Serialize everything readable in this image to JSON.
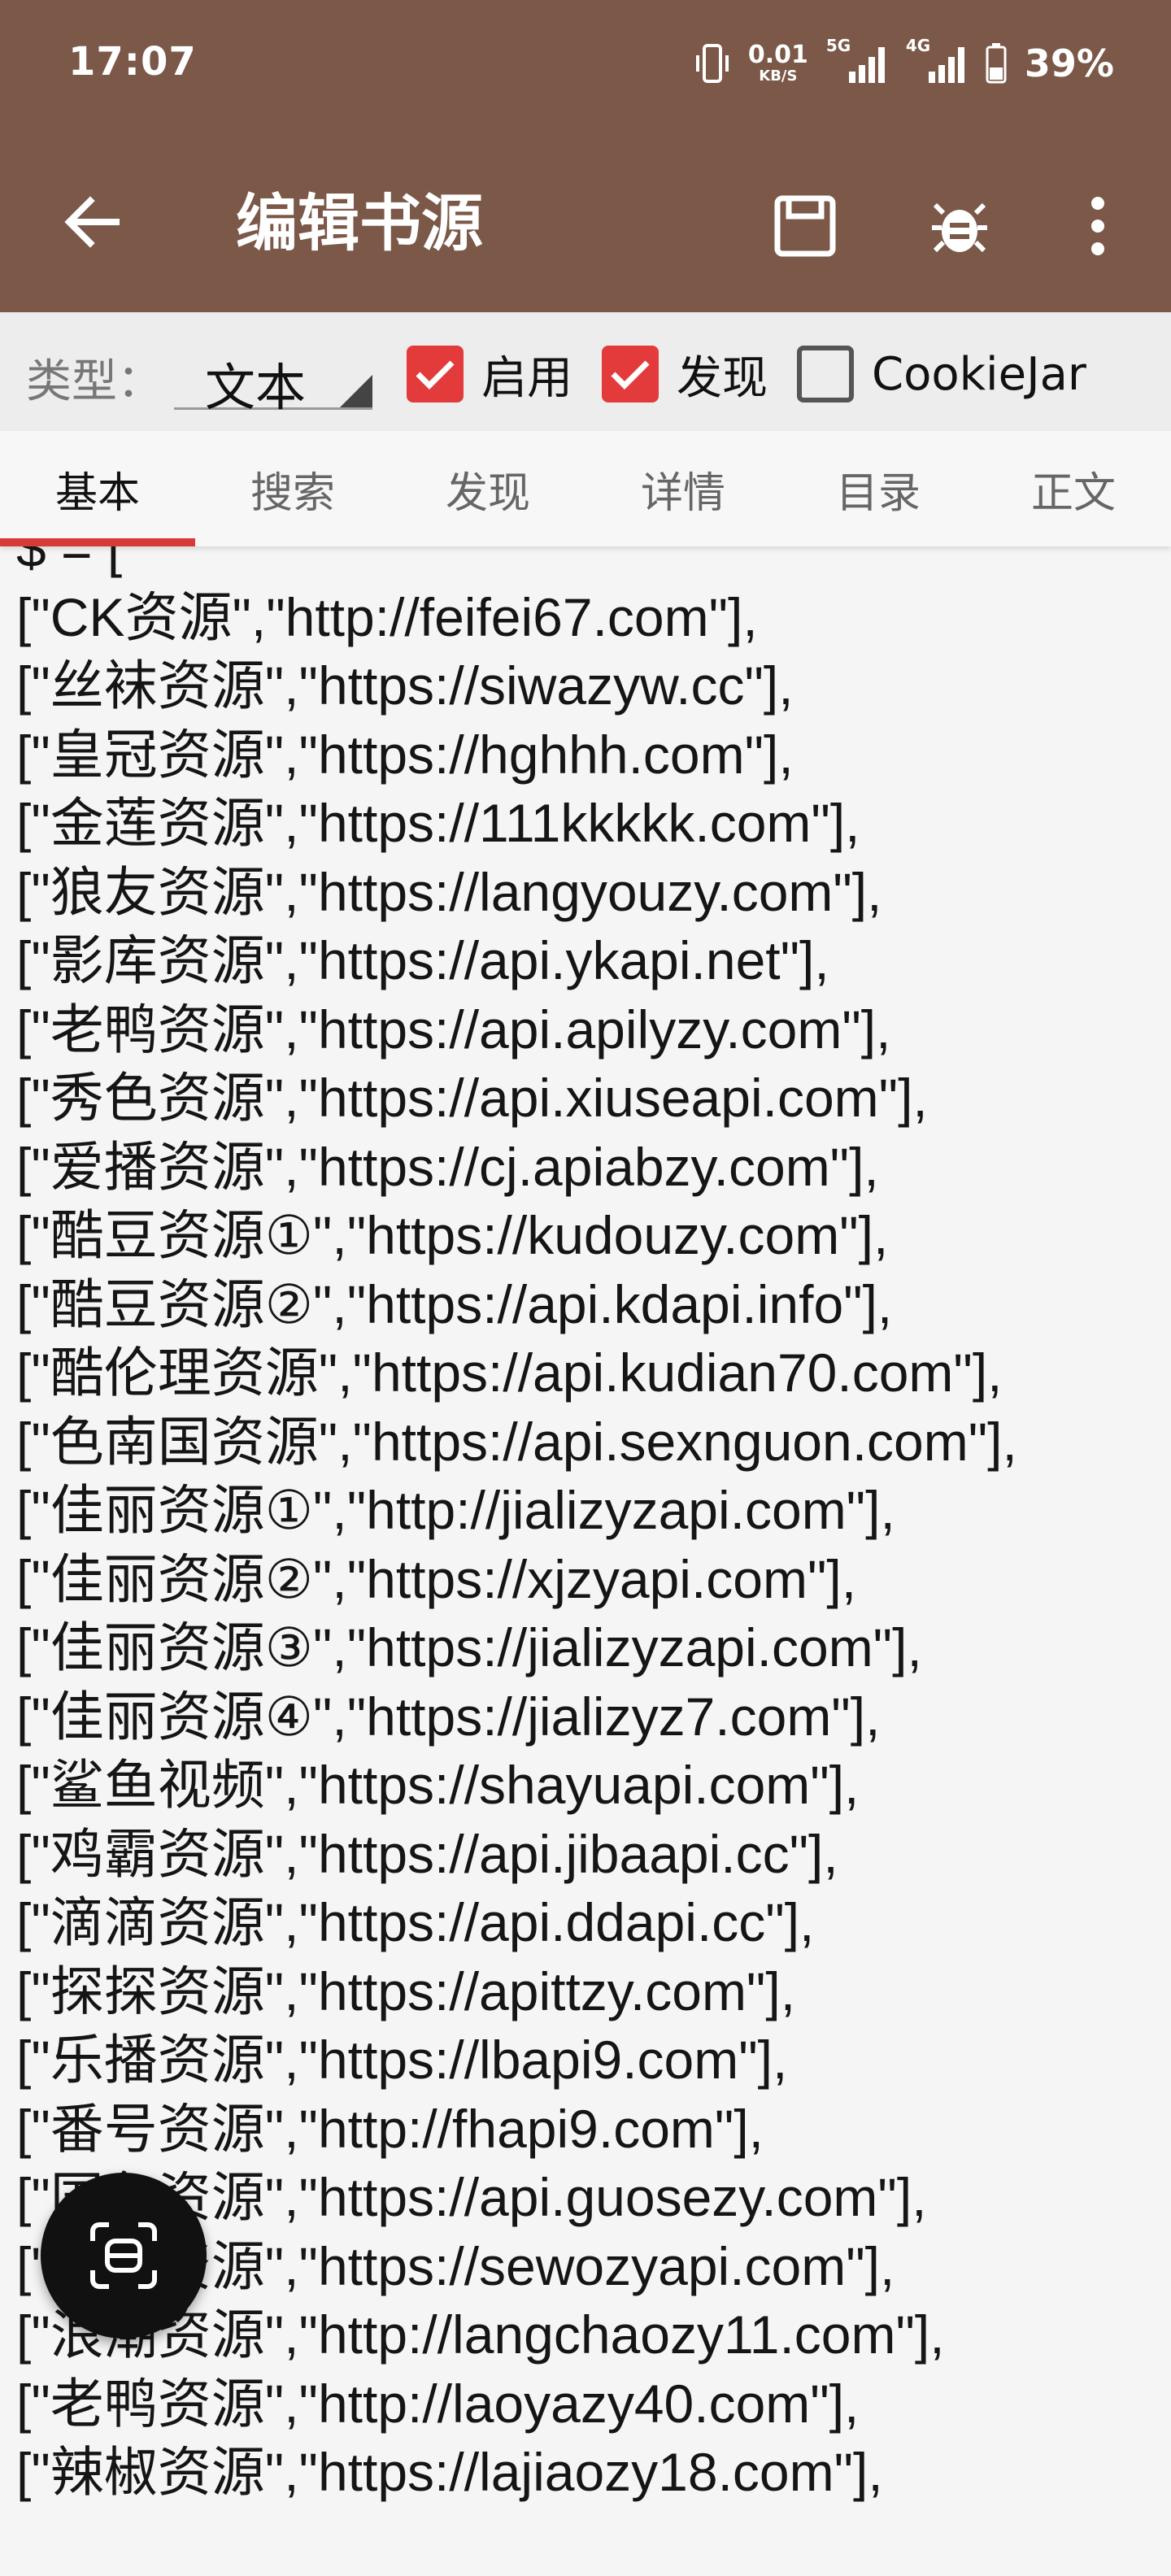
{
  "status_bar": {
    "time": "17:07",
    "net_speed_value": "0.01",
    "net_speed_unit": "KB/S",
    "sim1_label": "5G",
    "sim2_label": "4G",
    "battery": "39%"
  },
  "app_bar": {
    "title": "编辑书源",
    "icons": [
      "back-arrow-icon",
      "save-icon",
      "bug-icon",
      "more-vert-icon"
    ]
  },
  "options": {
    "type_label": "类型：",
    "type_value": "文本",
    "checkboxes": [
      {
        "label": "启用",
        "checked": true
      },
      {
        "label": "发现",
        "checked": true
      },
      {
        "label": "CookieJar",
        "checked": false
      }
    ]
  },
  "tabs": [
    {
      "label": "基本",
      "active": true
    },
    {
      "label": "搜索",
      "active": false
    },
    {
      "label": "发现",
      "active": false
    },
    {
      "label": "详情",
      "active": false
    },
    {
      "label": "目录",
      "active": false
    },
    {
      "label": "正文",
      "active": false
    }
  ],
  "colors": {
    "app_bar": "#7b5848",
    "accent": "#e33b3b",
    "tab_indicator": "#d83a3a"
  },
  "code_lines": [
    "$ = [",
    "[\"CK资源\",\"http://feifei67.com\"],",
    "[\"丝袜资源\",\"https://siwazyw.cc\"],",
    "[\"皇冠资源\",\"https://hghhh.com\"],",
    "[\"金莲资源\",\"https://111kkkkk.com\"],",
    "[\"狼友资源\",\"https://langyouzy.com\"],",
    "[\"影库资源\",\"https://api.ykapi.net\"],",
    "[\"老鸭资源\",\"https://api.apilyzy.com\"],",
    "[\"秀色资源\",\"https://api.xiuseapi.com\"],",
    "[\"爱播资源\",\"https://cj.apiabzy.com\"],",
    "[\"酷豆资源①\",\"https://kudouzy.com\"],",
    "[\"酷豆资源②\",\"https://api.kdapi.info\"],",
    "[\"酷伦理资源\",\"https://api.kudian70.com\"],",
    "[\"色南国资源\",\"https://api.sexnguon.com\"],",
    "[\"佳丽资源①\",\"http://jializyzapi.com\"],",
    "[\"佳丽资源②\",\"https://xjzyapi.com\"],",
    "[\"佳丽资源③\",\"https://jializyzapi.com\"],",
    "[\"佳丽资源④\",\"https://jializyz7.com\"],",
    "[\"鲨鱼视频\",\"https://shayuapi.com\"],",
    "[\"鸡霸资源\",\"https://api.jibaapi.cc\"],",
    "[\"滴滴资源\",\"https://api.ddapi.cc\"],",
    "[\"探探资源\",\"https://apittzy.com\"],",
    "[\"乐播资源\",\"https://lbapi9.com\"],",
    "[\"番号资源\",\"http://fhapi9.com\"],",
    "[\"国色资源\",\"https://api.guosezy.com\"],",
    "[\"色窝资源\",\"https://sewozyapi.com\"],",
    "[\"浪潮资源\",\"http://langchaozy11.com\"],",
    "[\"老鸭资源\",\"http://laoyazy40.com\"],",
    "[\"辣椒资源\",\"https://lajiaozy18.com\"],"
  ],
  "fab": {
    "icon": "scan-icon"
  }
}
